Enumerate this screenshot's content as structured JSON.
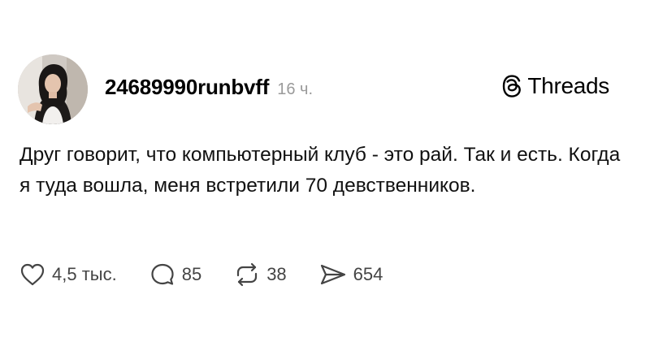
{
  "post": {
    "author": {
      "username": "24689990runbvff",
      "avatar_icon": "avatar-photo"
    },
    "time": "16 ч.",
    "brand": {
      "icon": "threads-logo-icon",
      "name": "Threads"
    },
    "text": "Друг говорит, что компьютерный клуб - это рай. Так и есть. Когда я туда вошла, меня встретили 70 девственников.",
    "actions": {
      "like": {
        "icon": "heart-icon",
        "count": "4,5 тыс."
      },
      "comment": {
        "icon": "comment-bubble-icon",
        "count": "85"
      },
      "repost": {
        "icon": "repost-icon",
        "count": "38"
      },
      "share": {
        "icon": "send-icon",
        "count": "654"
      }
    }
  },
  "colors": {
    "background": "#ffffff",
    "text": "#111111",
    "muted": "#9a9a9a",
    "icon": "#444444"
  }
}
